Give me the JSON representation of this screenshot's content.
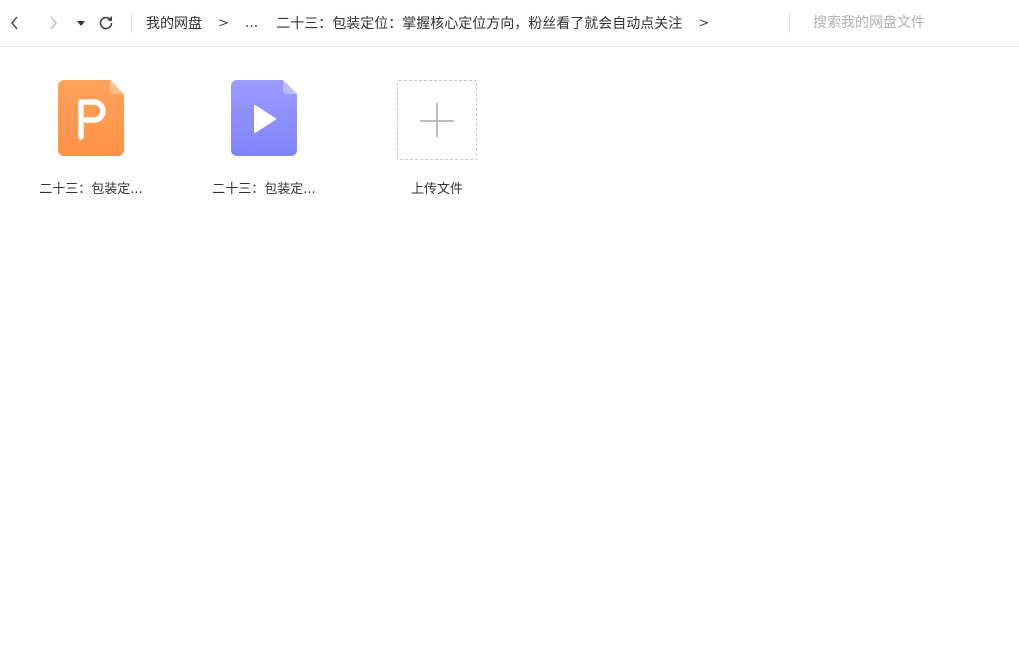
{
  "toolbar": {
    "back_icon": "chevron-left-icon",
    "forward_icon": "chevron-right-icon",
    "dropdown_icon": "caret-down-icon",
    "refresh_icon": "refresh-icon",
    "breadcrumb": {
      "root": "我的网盘",
      "separator": ">",
      "ellipsis": "...",
      "current": "二十三：包装定位：掌握核心定位方向，粉丝看了就会自动点关注"
    },
    "search_placeholder": "搜索我的网盘文件"
  },
  "files": [
    {
      "label": "二十三：包装定...",
      "icon": "ppt-file-icon",
      "color_top": "#ffa35c",
      "color_bottom": "#ff9146"
    },
    {
      "label": "二十三：包装定...",
      "icon": "video-file-icon",
      "color_top": "#9a9cff",
      "color_bottom": "#7f84fb"
    }
  ],
  "upload": {
    "label": "上传文件",
    "icon": "plus-icon"
  }
}
